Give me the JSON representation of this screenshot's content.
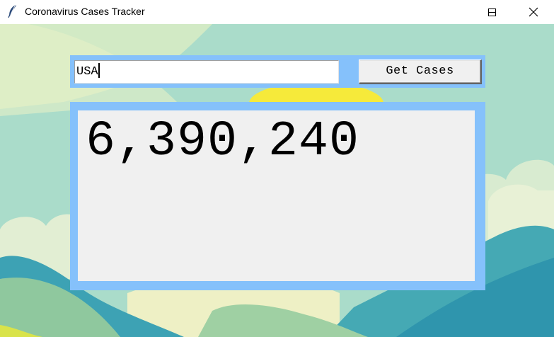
{
  "window": {
    "title": "Coronavirus Cases Tracker",
    "icon": "feather-icon",
    "controls": [
      "minimize-icon",
      "maximize-icon",
      "close-icon"
    ]
  },
  "search": {
    "value": "USA"
  },
  "button": {
    "label": "Get Cases"
  },
  "result": {
    "cases": "6,390,240"
  },
  "colors": {
    "frame": "#85c1fb",
    "panel": "#f0f0f0",
    "sky": "#a9dcc9",
    "sun": "#f6ea3a",
    "hills": "#46a7b6"
  }
}
